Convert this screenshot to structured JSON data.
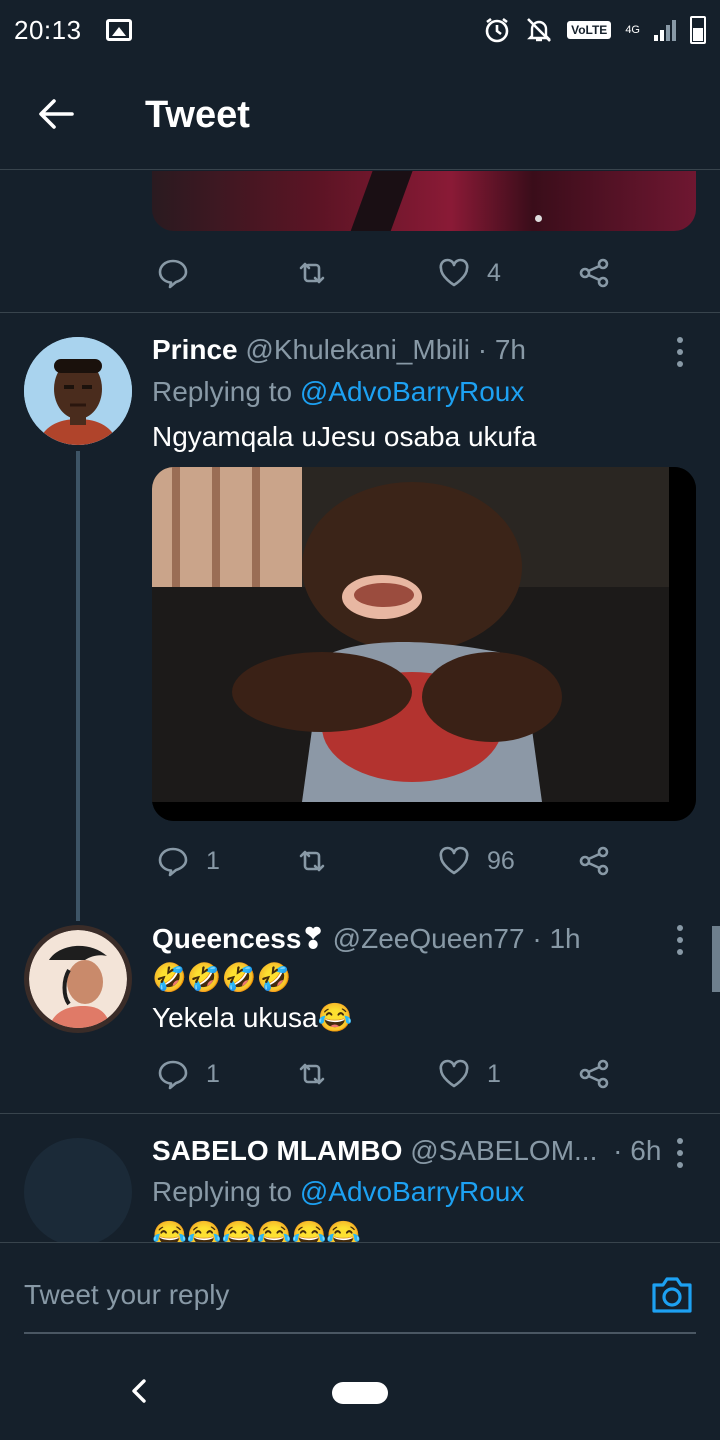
{
  "status_bar": {
    "time": "20:13",
    "network_badge": "VoLTE",
    "network_type": "4G"
  },
  "header": {
    "title": "Tweet",
    "back_icon": "arrow-left-icon"
  },
  "top_tweet": {
    "like_count": "4"
  },
  "tweets": [
    {
      "name": "Prince",
      "handle": "@Khulekani_Mbili",
      "time": "· 7h",
      "replying_prefix": "Replying to ",
      "replying_to": "@AdvoBarryRoux",
      "text": "Ngyamqala uJesu osaba ukufa",
      "reply_count": "1",
      "like_count": "96"
    },
    {
      "name": "Queencess",
      "name_emoji": "❣",
      "handle": "@ZeeQueen77",
      "time": "· 1h",
      "text_line1": "🤣🤣🤣🤣",
      "text_line2": "Yekela ukusa😂",
      "reply_count": "1",
      "like_count": "1"
    },
    {
      "name": "SABELO MLAMBO",
      "handle": "@SABELOM...",
      "time": "· 6h",
      "replying_prefix": "Replying to ",
      "replying_to": "@AdvoBarryRoux",
      "text": "😂😂😂😂😂😂"
    }
  ],
  "reply_bar": {
    "placeholder": "Tweet your reply",
    "camera_icon": "camera-icon"
  },
  "colors": {
    "background": "#15202b",
    "secondary_text": "#8899a6",
    "link": "#1da1f2",
    "divider": "#38444d"
  }
}
